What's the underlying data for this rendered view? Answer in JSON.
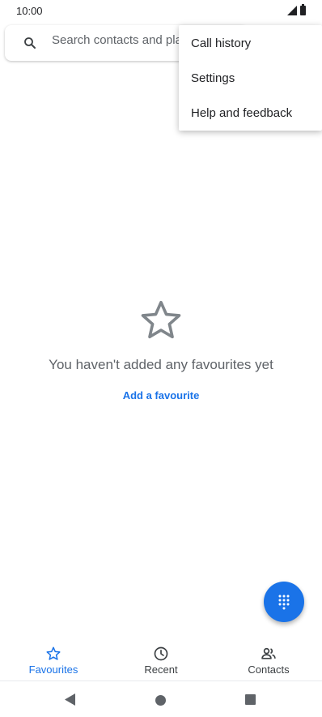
{
  "status_bar": {
    "time": "10:00"
  },
  "search": {
    "placeholder": "Search contacts and places"
  },
  "menu": {
    "items": [
      {
        "label": "Call history"
      },
      {
        "label": "Settings"
      },
      {
        "label": "Help and feedback"
      }
    ]
  },
  "empty_state": {
    "icon": "star-outline-icon",
    "message": "You haven't added any favourites yet",
    "action_label": "Add a favourite"
  },
  "fab": {
    "icon": "dialpad-icon"
  },
  "bottom_nav": {
    "tabs": [
      {
        "label": "Favourites",
        "icon": "star-icon",
        "active": true
      },
      {
        "label": "Recent",
        "icon": "clock-icon",
        "active": false
      },
      {
        "label": "Contacts",
        "icon": "people-icon",
        "active": false
      }
    ]
  },
  "colors": {
    "accent": "#1a73e8",
    "text_secondary": "#5f6368"
  }
}
